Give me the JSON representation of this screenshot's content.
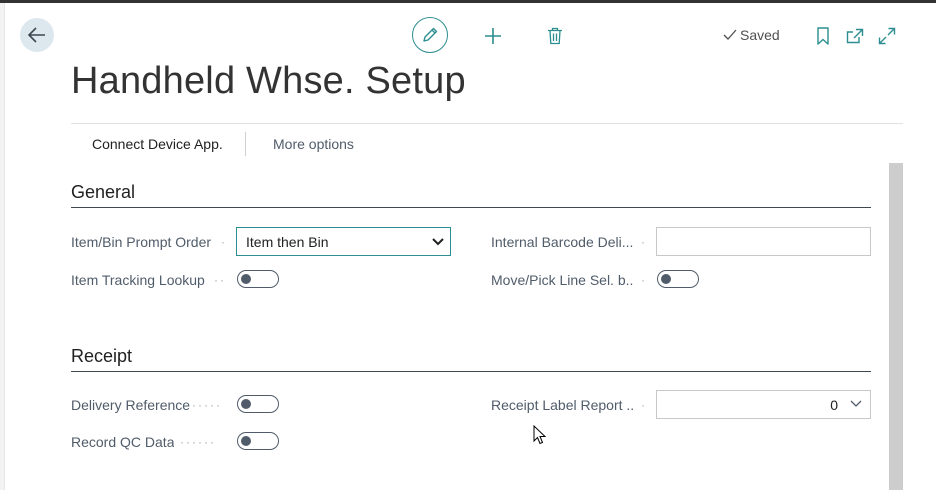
{
  "window": {
    "title": "Handheld Whse. Setup",
    "status": "Saved",
    "accent_color": "#2c8e90"
  },
  "toolbar": {
    "back_icon": "arrow-left-icon",
    "edit_icon": "pencil-icon",
    "add_icon": "plus-icon",
    "delete_icon": "trash-icon",
    "saved_icon": "checkmark-icon",
    "bookmark_icon": "bookmark-icon",
    "open_new_window_icon": "popout-icon",
    "expand_icon": "expand-icon"
  },
  "actions": {
    "connect_label": "Connect Device App.",
    "more_label": "More options"
  },
  "general": {
    "title": "General",
    "item_bin_prompt_order": {
      "label": "Item/Bin Prompt Order",
      "value": "Item then Bin"
    },
    "item_tracking_lookup": {
      "label": "Item Tracking Lookup",
      "value": false
    },
    "internal_barcode": {
      "label": "Internal Barcode Deli...",
      "value": ""
    },
    "move_pick_line": {
      "label": "Move/Pick Line Sel. b...",
      "value": false
    }
  },
  "receipt": {
    "title": "Receipt",
    "delivery_reference": {
      "label": "Delivery Reference",
      "value": false
    },
    "record_qc_data": {
      "label": "Record QC Data",
      "value": false
    },
    "receipt_label_report": {
      "label": "Receipt Label Report ...",
      "value": "0"
    }
  }
}
